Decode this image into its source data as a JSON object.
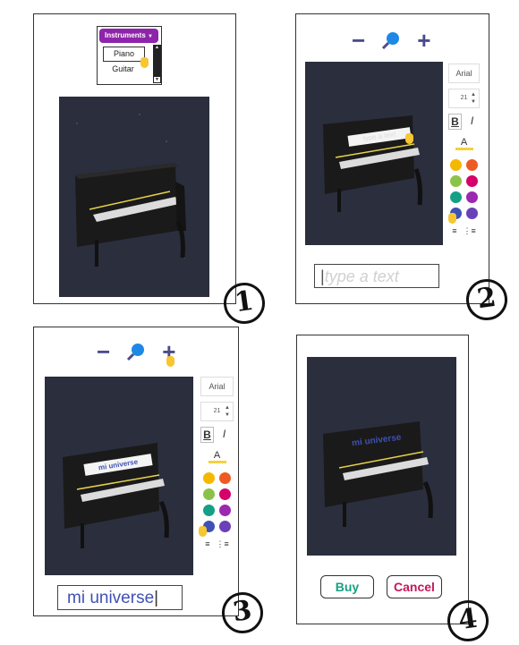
{
  "panel1": {
    "dropdown_label": "Instruments",
    "options": [
      "Piano",
      "Guitar"
    ],
    "step": "1"
  },
  "panel2": {
    "zoom_out": "−",
    "zoom_in": "+",
    "font_name": "Arial",
    "font_size": "21",
    "bold": "B",
    "italic": "I",
    "color_label": "A",
    "text_placeholder": "type a text",
    "key_label": "type a text",
    "step": "2"
  },
  "panel3": {
    "zoom_out": "−",
    "zoom_in": "+",
    "font_name": "Arial",
    "font_size": "21",
    "bold": "B",
    "italic": "I",
    "color_label": "A",
    "text_value": "mi universe",
    "key_label": "mi universe",
    "step": "3"
  },
  "panel4": {
    "engraving": "mi universe",
    "buy_label": "Buy",
    "cancel_label": "Cancel",
    "step": "4"
  },
  "swatch_colors": [
    "#f5b800",
    "#ee5a24",
    "#8bc34a",
    "#d6006b",
    "#14a085",
    "#9c27b0",
    "#3f51b5",
    "#6a3fb8"
  ],
  "colors": {
    "dropdown_purple": "#8e24aa",
    "icon_indigo": "#4b4b8a",
    "buy_green": "#16a085",
    "cancel_pink": "#c2185b",
    "scene_bg": "#2b2e3d"
  }
}
